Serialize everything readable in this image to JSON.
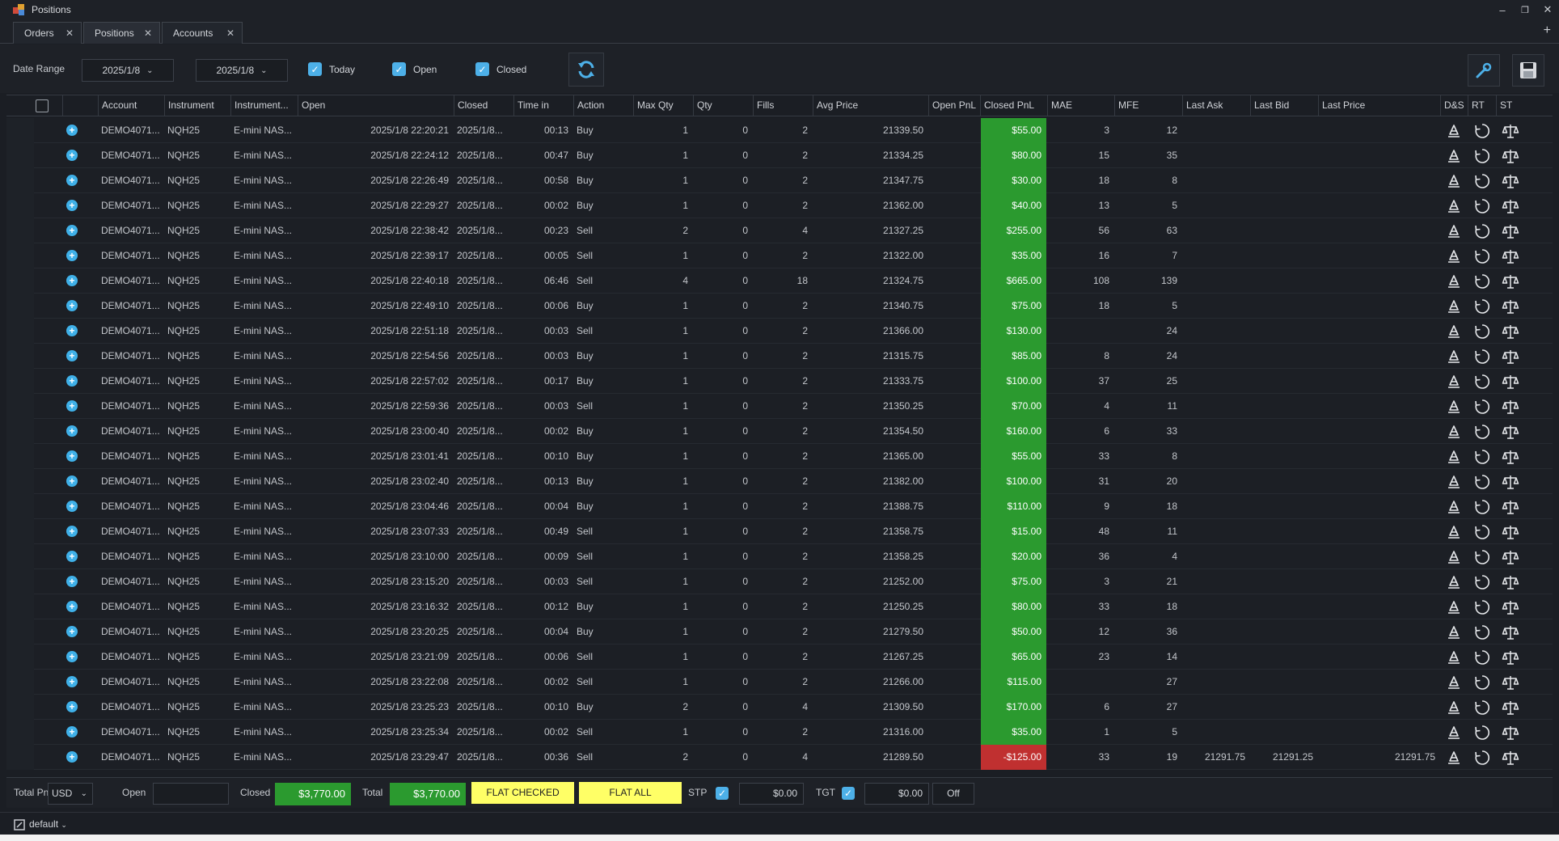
{
  "window": {
    "title": "Positions"
  },
  "tabs": [
    {
      "label": "Orders",
      "active": false
    },
    {
      "label": "Positions",
      "active": true
    },
    {
      "label": "Accounts",
      "active": false
    }
  ],
  "toolbar": {
    "date_range_label": "Date Range",
    "date_from": "2025/1/8",
    "date_to": "2025/1/8",
    "filters": [
      {
        "label": "Today",
        "checked": true
      },
      {
        "label": "Open",
        "checked": true
      },
      {
        "label": "Closed",
        "checked": true
      }
    ]
  },
  "columns": [
    "Account",
    "Instrument",
    "Instrument...",
    "Open",
    "Closed",
    "Time in",
    "Action",
    "Max Qty",
    "Qty",
    "Fills",
    "Avg Price",
    "Open PnL",
    "Closed PnL",
    "MAE",
    "MFE",
    "Last Ask",
    "Last Bid",
    "Last Price",
    "D&S",
    "RT",
    "ST"
  ],
  "rows": [
    {
      "account": "DEMO4071...",
      "instrument": "NQH25",
      "instrument_desc": "E-mini NAS...",
      "open": "2025/1/8 22:20:21",
      "closed": "2025/1/8...",
      "time_in": "00:13",
      "action": "Buy",
      "max_qty": "1",
      "qty": "0",
      "fills": "2",
      "avg_price": "21339.50",
      "open_pnl": "",
      "closed_pnl": "$55.00",
      "pnl_sign": "pos",
      "mae": "3",
      "mfe": "12",
      "last_ask": "",
      "last_bid": "",
      "last_price": ""
    },
    {
      "account": "DEMO4071...",
      "instrument": "NQH25",
      "instrument_desc": "E-mini NAS...",
      "open": "2025/1/8 22:24:12",
      "closed": "2025/1/8...",
      "time_in": "00:47",
      "action": "Buy",
      "max_qty": "1",
      "qty": "0",
      "fills": "2",
      "avg_price": "21334.25",
      "open_pnl": "",
      "closed_pnl": "$80.00",
      "pnl_sign": "pos",
      "mae": "15",
      "mfe": "35",
      "last_ask": "",
      "last_bid": "",
      "last_price": ""
    },
    {
      "account": "DEMO4071...",
      "instrument": "NQH25",
      "instrument_desc": "E-mini NAS...",
      "open": "2025/1/8 22:26:49",
      "closed": "2025/1/8...",
      "time_in": "00:58",
      "action": "Buy",
      "max_qty": "1",
      "qty": "0",
      "fills": "2",
      "avg_price": "21347.75",
      "open_pnl": "",
      "closed_pnl": "$30.00",
      "pnl_sign": "pos",
      "mae": "18",
      "mfe": "8",
      "last_ask": "",
      "last_bid": "",
      "last_price": ""
    },
    {
      "account": "DEMO4071...",
      "instrument": "NQH25",
      "instrument_desc": "E-mini NAS...",
      "open": "2025/1/8 22:29:27",
      "closed": "2025/1/8...",
      "time_in": "00:02",
      "action": "Buy",
      "max_qty": "1",
      "qty": "0",
      "fills": "2",
      "avg_price": "21362.00",
      "open_pnl": "",
      "closed_pnl": "$40.00",
      "pnl_sign": "pos",
      "mae": "13",
      "mfe": "5",
      "last_ask": "",
      "last_bid": "",
      "last_price": ""
    },
    {
      "account": "DEMO4071...",
      "instrument": "NQH25",
      "instrument_desc": "E-mini NAS...",
      "open": "2025/1/8 22:38:42",
      "closed": "2025/1/8...",
      "time_in": "00:23",
      "action": "Sell",
      "max_qty": "2",
      "qty": "0",
      "fills": "4",
      "avg_price": "21327.25",
      "open_pnl": "",
      "closed_pnl": "$255.00",
      "pnl_sign": "pos",
      "mae": "56",
      "mfe": "63",
      "last_ask": "",
      "last_bid": "",
      "last_price": ""
    },
    {
      "account": "DEMO4071...",
      "instrument": "NQH25",
      "instrument_desc": "E-mini NAS...",
      "open": "2025/1/8 22:39:17",
      "closed": "2025/1/8...",
      "time_in": "00:05",
      "action": "Sell",
      "max_qty": "1",
      "qty": "0",
      "fills": "2",
      "avg_price": "21322.00",
      "open_pnl": "",
      "closed_pnl": "$35.00",
      "pnl_sign": "pos",
      "mae": "16",
      "mfe": "7",
      "last_ask": "",
      "last_bid": "",
      "last_price": ""
    },
    {
      "account": "DEMO4071...",
      "instrument": "NQH25",
      "instrument_desc": "E-mini NAS...",
      "open": "2025/1/8 22:40:18",
      "closed": "2025/1/8...",
      "time_in": "06:46",
      "action": "Sell",
      "max_qty": "4",
      "qty": "0",
      "fills": "18",
      "avg_price": "21324.75",
      "open_pnl": "",
      "closed_pnl": "$665.00",
      "pnl_sign": "pos",
      "mae": "108",
      "mfe": "139",
      "last_ask": "",
      "last_bid": "",
      "last_price": ""
    },
    {
      "account": "DEMO4071...",
      "instrument": "NQH25",
      "instrument_desc": "E-mini NAS...",
      "open": "2025/1/8 22:49:10",
      "closed": "2025/1/8...",
      "time_in": "00:06",
      "action": "Buy",
      "max_qty": "1",
      "qty": "0",
      "fills": "2",
      "avg_price": "21340.75",
      "open_pnl": "",
      "closed_pnl": "$75.00",
      "pnl_sign": "pos",
      "mae": "18",
      "mfe": "5",
      "last_ask": "",
      "last_bid": "",
      "last_price": ""
    },
    {
      "account": "DEMO4071...",
      "instrument": "NQH25",
      "instrument_desc": "E-mini NAS...",
      "open": "2025/1/8 22:51:18",
      "closed": "2025/1/8...",
      "time_in": "00:03",
      "action": "Sell",
      "max_qty": "1",
      "qty": "0",
      "fills": "2",
      "avg_price": "21366.00",
      "open_pnl": "",
      "closed_pnl": "$130.00",
      "pnl_sign": "pos",
      "mae": "",
      "mfe": "24",
      "last_ask": "",
      "last_bid": "",
      "last_price": ""
    },
    {
      "account": "DEMO4071...",
      "instrument": "NQH25",
      "instrument_desc": "E-mini NAS...",
      "open": "2025/1/8 22:54:56",
      "closed": "2025/1/8...",
      "time_in": "00:03",
      "action": "Buy",
      "max_qty": "1",
      "qty": "0",
      "fills": "2",
      "avg_price": "21315.75",
      "open_pnl": "",
      "closed_pnl": "$85.00",
      "pnl_sign": "pos",
      "mae": "8",
      "mfe": "24",
      "last_ask": "",
      "last_bid": "",
      "last_price": ""
    },
    {
      "account": "DEMO4071...",
      "instrument": "NQH25",
      "instrument_desc": "E-mini NAS...",
      "open": "2025/1/8 22:57:02",
      "closed": "2025/1/8...",
      "time_in": "00:17",
      "action": "Buy",
      "max_qty": "1",
      "qty": "0",
      "fills": "2",
      "avg_price": "21333.75",
      "open_pnl": "",
      "closed_pnl": "$100.00",
      "pnl_sign": "pos",
      "mae": "37",
      "mfe": "25",
      "last_ask": "",
      "last_bid": "",
      "last_price": ""
    },
    {
      "account": "DEMO4071...",
      "instrument": "NQH25",
      "instrument_desc": "E-mini NAS...",
      "open": "2025/1/8 22:59:36",
      "closed": "2025/1/8...",
      "time_in": "00:03",
      "action": "Sell",
      "max_qty": "1",
      "qty": "0",
      "fills": "2",
      "avg_price": "21350.25",
      "open_pnl": "",
      "closed_pnl": "$70.00",
      "pnl_sign": "pos",
      "mae": "4",
      "mfe": "11",
      "last_ask": "",
      "last_bid": "",
      "last_price": ""
    },
    {
      "account": "DEMO4071...",
      "instrument": "NQH25",
      "instrument_desc": "E-mini NAS...",
      "open": "2025/1/8 23:00:40",
      "closed": "2025/1/8...",
      "time_in": "00:02",
      "action": "Buy",
      "max_qty": "1",
      "qty": "0",
      "fills": "2",
      "avg_price": "21354.50",
      "open_pnl": "",
      "closed_pnl": "$160.00",
      "pnl_sign": "pos",
      "mae": "6",
      "mfe": "33",
      "last_ask": "",
      "last_bid": "",
      "last_price": ""
    },
    {
      "account": "DEMO4071...",
      "instrument": "NQH25",
      "instrument_desc": "E-mini NAS...",
      "open": "2025/1/8 23:01:41",
      "closed": "2025/1/8...",
      "time_in": "00:10",
      "action": "Buy",
      "max_qty": "1",
      "qty": "0",
      "fills": "2",
      "avg_price": "21365.00",
      "open_pnl": "",
      "closed_pnl": "$55.00",
      "pnl_sign": "pos",
      "mae": "33",
      "mfe": "8",
      "last_ask": "",
      "last_bid": "",
      "last_price": ""
    },
    {
      "account": "DEMO4071...",
      "instrument": "NQH25",
      "instrument_desc": "E-mini NAS...",
      "open": "2025/1/8 23:02:40",
      "closed": "2025/1/8...",
      "time_in": "00:13",
      "action": "Buy",
      "max_qty": "1",
      "qty": "0",
      "fills": "2",
      "avg_price": "21382.00",
      "open_pnl": "",
      "closed_pnl": "$100.00",
      "pnl_sign": "pos",
      "mae": "31",
      "mfe": "20",
      "last_ask": "",
      "last_bid": "",
      "last_price": ""
    },
    {
      "account": "DEMO4071...",
      "instrument": "NQH25",
      "instrument_desc": "E-mini NAS...",
      "open": "2025/1/8 23:04:46",
      "closed": "2025/1/8...",
      "time_in": "00:04",
      "action": "Buy",
      "max_qty": "1",
      "qty": "0",
      "fills": "2",
      "avg_price": "21388.75",
      "open_pnl": "",
      "closed_pnl": "$110.00",
      "pnl_sign": "pos",
      "mae": "9",
      "mfe": "18",
      "last_ask": "",
      "last_bid": "",
      "last_price": ""
    },
    {
      "account": "DEMO4071...",
      "instrument": "NQH25",
      "instrument_desc": "E-mini NAS...",
      "open": "2025/1/8 23:07:33",
      "closed": "2025/1/8...",
      "time_in": "00:49",
      "action": "Sell",
      "max_qty": "1",
      "qty": "0",
      "fills": "2",
      "avg_price": "21358.75",
      "open_pnl": "",
      "closed_pnl": "$15.00",
      "pnl_sign": "pos",
      "mae": "48",
      "mfe": "11",
      "last_ask": "",
      "last_bid": "",
      "last_price": ""
    },
    {
      "account": "DEMO4071...",
      "instrument": "NQH25",
      "instrument_desc": "E-mini NAS...",
      "open": "2025/1/8 23:10:00",
      "closed": "2025/1/8...",
      "time_in": "00:09",
      "action": "Sell",
      "max_qty": "1",
      "qty": "0",
      "fills": "2",
      "avg_price": "21358.25",
      "open_pnl": "",
      "closed_pnl": "$20.00",
      "pnl_sign": "pos",
      "mae": "36",
      "mfe": "4",
      "last_ask": "",
      "last_bid": "",
      "last_price": ""
    },
    {
      "account": "DEMO4071...",
      "instrument": "NQH25",
      "instrument_desc": "E-mini NAS...",
      "open": "2025/1/8 23:15:20",
      "closed": "2025/1/8...",
      "time_in": "00:03",
      "action": "Sell",
      "max_qty": "1",
      "qty": "0",
      "fills": "2",
      "avg_price": "21252.00",
      "open_pnl": "",
      "closed_pnl": "$75.00",
      "pnl_sign": "pos",
      "mae": "3",
      "mfe": "21",
      "last_ask": "",
      "last_bid": "",
      "last_price": ""
    },
    {
      "account": "DEMO4071...",
      "instrument": "NQH25",
      "instrument_desc": "E-mini NAS...",
      "open": "2025/1/8 23:16:32",
      "closed": "2025/1/8...",
      "time_in": "00:12",
      "action": "Buy",
      "max_qty": "1",
      "qty": "0",
      "fills": "2",
      "avg_price": "21250.25",
      "open_pnl": "",
      "closed_pnl": "$80.00",
      "pnl_sign": "pos",
      "mae": "33",
      "mfe": "18",
      "last_ask": "",
      "last_bid": "",
      "last_price": ""
    },
    {
      "account": "DEMO4071...",
      "instrument": "NQH25",
      "instrument_desc": "E-mini NAS...",
      "open": "2025/1/8 23:20:25",
      "closed": "2025/1/8...",
      "time_in": "00:04",
      "action": "Buy",
      "max_qty": "1",
      "qty": "0",
      "fills": "2",
      "avg_price": "21279.50",
      "open_pnl": "",
      "closed_pnl": "$50.00",
      "pnl_sign": "pos",
      "mae": "12",
      "mfe": "36",
      "last_ask": "",
      "last_bid": "",
      "last_price": ""
    },
    {
      "account": "DEMO4071...",
      "instrument": "NQH25",
      "instrument_desc": "E-mini NAS...",
      "open": "2025/1/8 23:21:09",
      "closed": "2025/1/8...",
      "time_in": "00:06",
      "action": "Sell",
      "max_qty": "1",
      "qty": "0",
      "fills": "2",
      "avg_price": "21267.25",
      "open_pnl": "",
      "closed_pnl": "$65.00",
      "pnl_sign": "pos",
      "mae": "23",
      "mfe": "14",
      "last_ask": "",
      "last_bid": "",
      "last_price": ""
    },
    {
      "account": "DEMO4071...",
      "instrument": "NQH25",
      "instrument_desc": "E-mini NAS...",
      "open": "2025/1/8 23:22:08",
      "closed": "2025/1/8...",
      "time_in": "00:02",
      "action": "Sell",
      "max_qty": "1",
      "qty": "0",
      "fills": "2",
      "avg_price": "21266.00",
      "open_pnl": "",
      "closed_pnl": "$115.00",
      "pnl_sign": "pos",
      "mae": "",
      "mfe": "27",
      "last_ask": "",
      "last_bid": "",
      "last_price": ""
    },
    {
      "account": "DEMO4071...",
      "instrument": "NQH25",
      "instrument_desc": "E-mini NAS...",
      "open": "2025/1/8 23:25:23",
      "closed": "2025/1/8...",
      "time_in": "00:10",
      "action": "Buy",
      "max_qty": "2",
      "qty": "0",
      "fills": "4",
      "avg_price": "21309.50",
      "open_pnl": "",
      "closed_pnl": "$170.00",
      "pnl_sign": "pos",
      "mae": "6",
      "mfe": "27",
      "last_ask": "",
      "last_bid": "",
      "last_price": ""
    },
    {
      "account": "DEMO4071...",
      "instrument": "NQH25",
      "instrument_desc": "E-mini NAS...",
      "open": "2025/1/8 23:25:34",
      "closed": "2025/1/8...",
      "time_in": "00:02",
      "action": "Sell",
      "max_qty": "1",
      "qty": "0",
      "fills": "2",
      "avg_price": "21316.00",
      "open_pnl": "",
      "closed_pnl": "$35.00",
      "pnl_sign": "pos",
      "mae": "1",
      "mfe": "5",
      "last_ask": "",
      "last_bid": "",
      "last_price": ""
    },
    {
      "account": "DEMO4071...",
      "instrument": "NQH25",
      "instrument_desc": "E-mini NAS...",
      "open": "2025/1/8 23:29:47",
      "closed": "2025/1/8...",
      "time_in": "00:36",
      "action": "Sell",
      "max_qty": "2",
      "qty": "0",
      "fills": "4",
      "avg_price": "21289.50",
      "open_pnl": "",
      "closed_pnl": "-$125.00",
      "pnl_sign": "neg",
      "mae": "33",
      "mfe": "19",
      "last_ask": "21291.75",
      "last_bid": "21291.25",
      "last_price": "21291.75"
    }
  ],
  "footer": {
    "total_pnl_label": "Total PnL",
    "currency": "USD",
    "open_label": "Open",
    "open_value": "",
    "closed_label": "Closed",
    "closed_value": "$3,770.00",
    "total_label": "Total",
    "total_value": "$3,770.00",
    "flat_checked_label": "FLAT CHECKED",
    "flat_all_label": "FLAT ALL",
    "stp_label": "STP",
    "stp_value": "$0.00",
    "tgt_label": "TGT",
    "tgt_value": "$0.00",
    "off_label": "Off"
  },
  "status": {
    "workspace": "default"
  },
  "colors": {
    "profit": "#2b9a2f",
    "loss": "#c03030",
    "accent": "#4db0e8",
    "flat_button": "#ffff66"
  }
}
